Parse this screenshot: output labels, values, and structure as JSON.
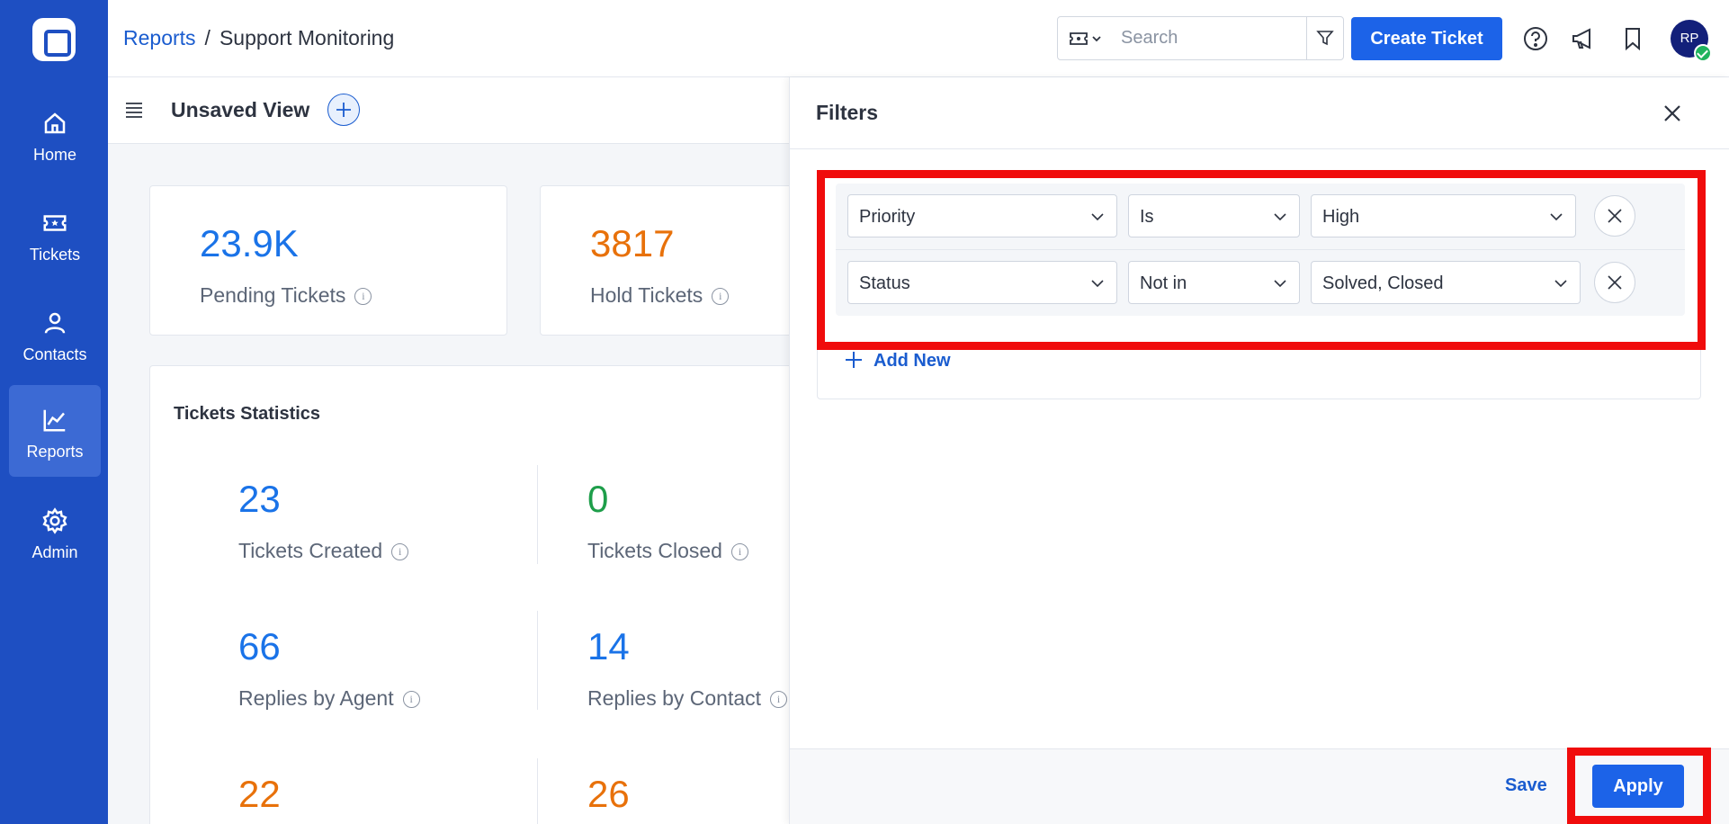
{
  "sidebar": {
    "logo": "app-logo",
    "items": [
      {
        "label": "Home",
        "icon": "home-icon"
      },
      {
        "label": "Tickets",
        "icon": "ticket-icon"
      },
      {
        "label": "Contacts",
        "icon": "contact-icon"
      },
      {
        "label": "Reports",
        "icon": "chart-line-icon",
        "active": true
      },
      {
        "label": "Admin",
        "icon": "gear-icon"
      }
    ]
  },
  "header": {
    "breadcrumb": {
      "parent": "Reports",
      "separator": "/",
      "current": "Support Monitoring"
    },
    "search": {
      "placeholder": "Search",
      "value": ""
    },
    "create_button": "Create Ticket",
    "avatar_initials": "RP"
  },
  "view": {
    "title": "Unsaved View"
  },
  "cards": {
    "pending": {
      "value": "23.9K",
      "label": "Pending Tickets"
    },
    "hold": {
      "value": "3817",
      "label": "Hold Tickets"
    }
  },
  "statistics": {
    "title": "Tickets Statistics",
    "items": [
      {
        "value": "23",
        "label": "Tickets Created"
      },
      {
        "value": "0",
        "label": "Tickets Closed"
      },
      {
        "value": "66",
        "label": "Replies by Agent"
      },
      {
        "value": "14",
        "label": "Replies by Contact"
      },
      {
        "value": "22",
        "label": ""
      },
      {
        "value": "26",
        "label": ""
      }
    ]
  },
  "filters": {
    "title": "Filters",
    "rows": [
      {
        "field": "Priority",
        "operator": "Is",
        "value": "High"
      },
      {
        "field": "Status",
        "operator": "Not in",
        "value": "Solved, Closed"
      }
    ],
    "add_new": "Add New",
    "save": "Save",
    "apply": "Apply"
  },
  "colors": {
    "sidebar": "#1e4fc2",
    "primary": "#1c63e8",
    "blue_value": "#1a73e8",
    "orange_value": "#e8710a",
    "green_value": "#1e9e4a",
    "highlight": "#f00c0c"
  }
}
